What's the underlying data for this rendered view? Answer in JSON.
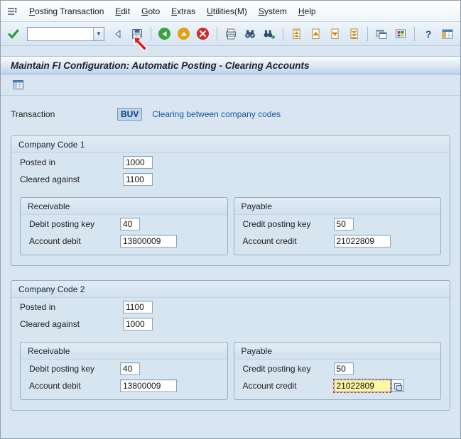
{
  "menu": {
    "items": [
      "Posting Transaction",
      "Edit",
      "Goto",
      "Extras",
      "Utilities(M)",
      "System",
      "Help"
    ]
  },
  "toolbar": {
    "command_value": "",
    "icons": [
      "enter",
      "command-field",
      "collapse-command-field",
      "save",
      "back",
      "exit",
      "cancel",
      "print",
      "find",
      "find-next",
      "first-page",
      "previous-page",
      "next-page",
      "last-page",
      "new-session",
      "create-shortcut",
      "help",
      "customize-layout"
    ]
  },
  "titlebar": {
    "title": "Maintain FI Configuration: Automatic Posting - Clearing Accounts"
  },
  "transaction": {
    "label": "Transaction",
    "code": "BUV",
    "description": "Clearing between company codes"
  },
  "company_code_1": {
    "title": "Company Code 1",
    "posted_in_label": "Posted in",
    "posted_in_value": "1000",
    "cleared_against_label": "Cleared against",
    "cleared_against_value": "1100",
    "receivable_title": "Receivable",
    "debit_posting_key_label": "Debit posting key",
    "debit_posting_key_value": "40",
    "account_debit_label": "Account debit",
    "account_debit_value": "13800009",
    "payable_title": "Payable",
    "credit_posting_key_label": "Credit posting key",
    "credit_posting_key_value": "50",
    "account_credit_label": "Account credit",
    "account_credit_value": "21022809"
  },
  "company_code_2": {
    "title": "Company Code 2",
    "posted_in_label": "Posted in",
    "posted_in_value": "1100",
    "cleared_against_label": "Cleared against",
    "cleared_against_value": "1000",
    "receivable_title": "Receivable",
    "debit_posting_key_label": "Debit posting key",
    "debit_posting_key_value": "40",
    "account_debit_label": "Account debit",
    "account_debit_value": "13800009",
    "payable_title": "Payable",
    "credit_posting_key_label": "Credit posting key",
    "credit_posting_key_value": "50",
    "account_credit_label": "Account credit",
    "account_credit_value": "21022809"
  },
  "colors": {
    "focus_field_bg": "#fdf6a3",
    "link_text": "#1a56a0",
    "annotation_arrow": "#e01b1b",
    "title_band": "#bdd5e9",
    "page_background": "#d9e6f2"
  }
}
